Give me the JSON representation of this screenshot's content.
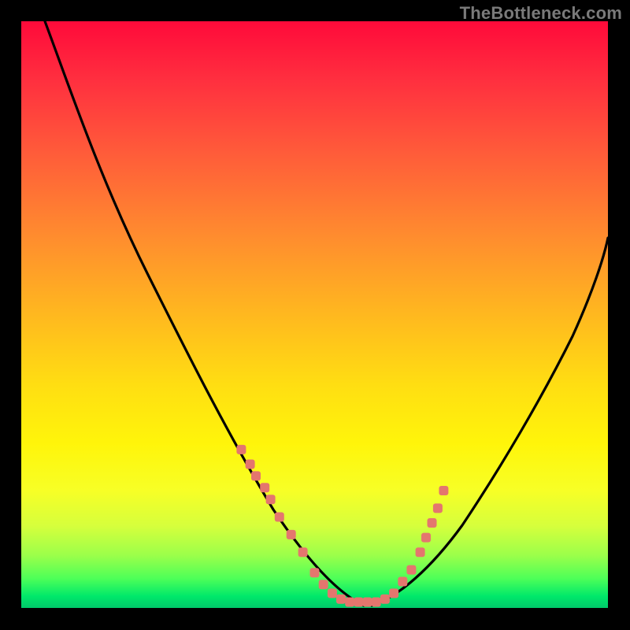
{
  "watermark": "TheBottleneck.com",
  "colors": {
    "page_bg": "#000000",
    "curve": "#000000",
    "marker": "#e4766e",
    "gradient_top": "#ff0a3a",
    "gradient_bottom": "#00c86a"
  },
  "chart_data": {
    "type": "line",
    "title": "",
    "xlabel": "",
    "ylabel": "",
    "xlim": [
      0,
      100
    ],
    "ylim": [
      0,
      100
    ],
    "grid": false,
    "legend": false,
    "series": [
      {
        "name": "left-curve",
        "x": [
          4,
          8,
          12,
          16,
          20,
          24,
          28,
          32,
          36,
          40,
          44,
          48,
          52,
          56,
          58,
          60
        ],
        "y": [
          100,
          92,
          83,
          74,
          65,
          56,
          47,
          38,
          30,
          22,
          15,
          9,
          5,
          2,
          1,
          0
        ]
      },
      {
        "name": "right-curve",
        "x": [
          60,
          62,
          64,
          68,
          72,
          76,
          80,
          84,
          88,
          92,
          96,
          100
        ],
        "y": [
          0,
          1,
          2,
          5,
          10,
          16,
          23,
          31,
          40,
          49,
          57,
          63
        ]
      }
    ],
    "markers": {
      "name": "highlight-dots",
      "x": [
        37.5,
        39.0,
        40.0,
        41.5,
        42.5,
        44.0,
        46.0,
        48.0,
        50.0,
        51.5,
        53.0,
        54.5,
        56.0,
        57.5,
        59.0,
        60.5,
        62.0,
        63.5,
        65.0,
        66.5,
        68.0,
        69.0,
        70.0,
        71.0,
        72.0
      ],
      "y": [
        27.0,
        24.5,
        22.5,
        20.5,
        18.5,
        15.5,
        12.5,
        9.5,
        6.0,
        4.0,
        2.5,
        1.5,
        1.0,
        1.0,
        1.0,
        1.0,
        1.5,
        2.5,
        4.5,
        6.5,
        9.5,
        12.0,
        14.5,
        17.0,
        20.0
      ]
    },
    "background_gradient": "vertical red→yellow→green"
  }
}
